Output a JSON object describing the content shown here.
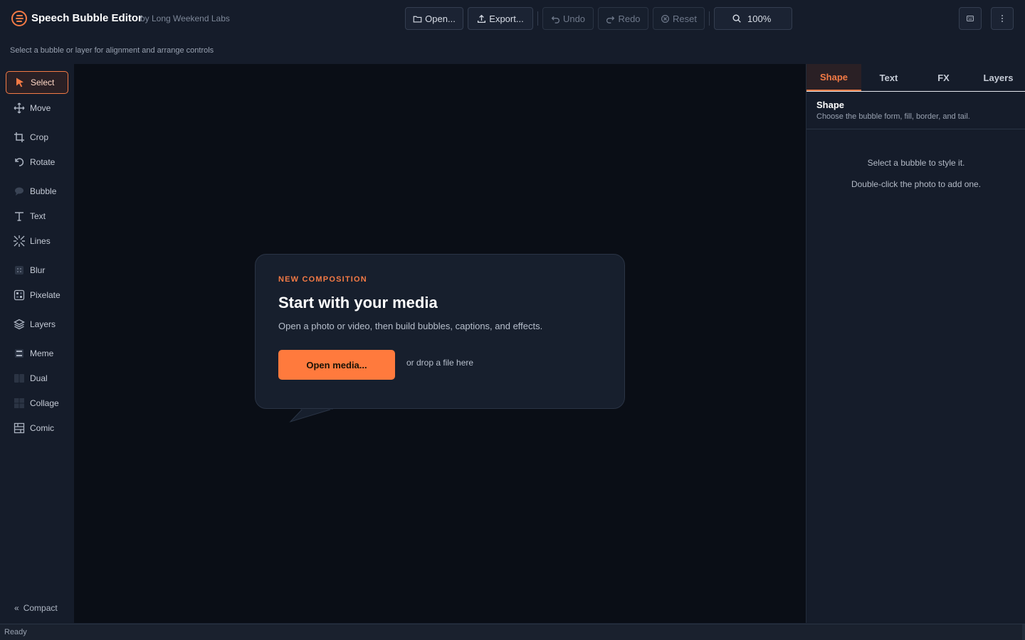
{
  "app": {
    "title": "Speech Bubble Editor",
    "byline": "by Long Weekend Labs",
    "hint": "Select a bubble or layer for alignment and arrange controls"
  },
  "toolbar": {
    "open": "Open...",
    "export": "Export...",
    "undo": "Undo",
    "redo": "Redo",
    "reset": "Reset",
    "zoom": "100%"
  },
  "tools": [
    {
      "label": "Select",
      "icon": "cursor-icon",
      "active": true
    },
    {
      "label": "Move",
      "icon": "move-icon"
    },
    {
      "label": "Crop",
      "icon": "crop-icon"
    },
    {
      "label": "Rotate",
      "icon": "rotate-icon"
    },
    {
      "label": "Bubble",
      "icon": "speech-bubble-icon"
    },
    {
      "label": "Text",
      "icon": "text-icon"
    },
    {
      "label": "Lines",
      "icon": "speed-lines-icon"
    },
    {
      "label": "Blur",
      "icon": "blur-icon"
    },
    {
      "label": "Pixelate",
      "icon": "pixelate-icon"
    },
    {
      "label": "Layers",
      "icon": "layers-icon"
    },
    {
      "label": "Meme",
      "icon": "meme-icon"
    },
    {
      "label": "Dual",
      "icon": "dual-panel-icon"
    },
    {
      "label": "Collage",
      "icon": "collage-icon"
    },
    {
      "label": "Comic",
      "icon": "comic-grid-icon"
    }
  ],
  "compact": {
    "label": "Compact"
  },
  "welcome": {
    "eyebrow": "NEW COMPOSITION",
    "title": "Start with your media",
    "subtitle": "Open a photo or video, then build bubbles, captions, and effects.",
    "button": "Open media...",
    "drop_hint": "or drop a file here"
  },
  "panel": {
    "tabs": [
      "Shape",
      "Text",
      "FX",
      "Layers"
    ],
    "active_tab": "Shape",
    "section_title": "Shape",
    "section_desc": "Choose the bubble form, fill, border, and tail.",
    "empty_line1": "Select a bubble to style it.",
    "empty_line2": "Double-click the photo to add one."
  },
  "status": {
    "text": "Ready"
  },
  "colors": {
    "accent": "#f47a45",
    "button": "#ff7a3d",
    "canvas": "#0a0e16",
    "chrome": "#151c2a"
  }
}
